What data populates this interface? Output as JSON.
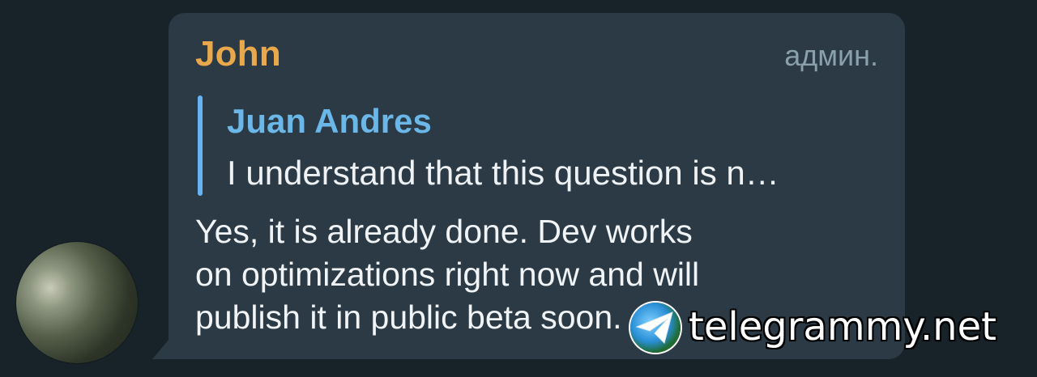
{
  "chat": {
    "sender_name": "John",
    "sender_role": "админ.",
    "reply": {
      "author": "Juan Andres",
      "text": "I understand that this question is n…"
    },
    "message_lines": [
      "Yes, it is already done. Dev works",
      "on optimizations right now and will",
      "publish it in public beta soon."
    ],
    "time": ""
  },
  "watermark": {
    "text": "telegrammy.net",
    "icon": "paper-plane-globe-icon"
  },
  "colors": {
    "background": "#172229",
    "bubble": "#2b3a45",
    "sender_name": "#e9a84c",
    "reply_accent": "#6ab3f3"
  }
}
